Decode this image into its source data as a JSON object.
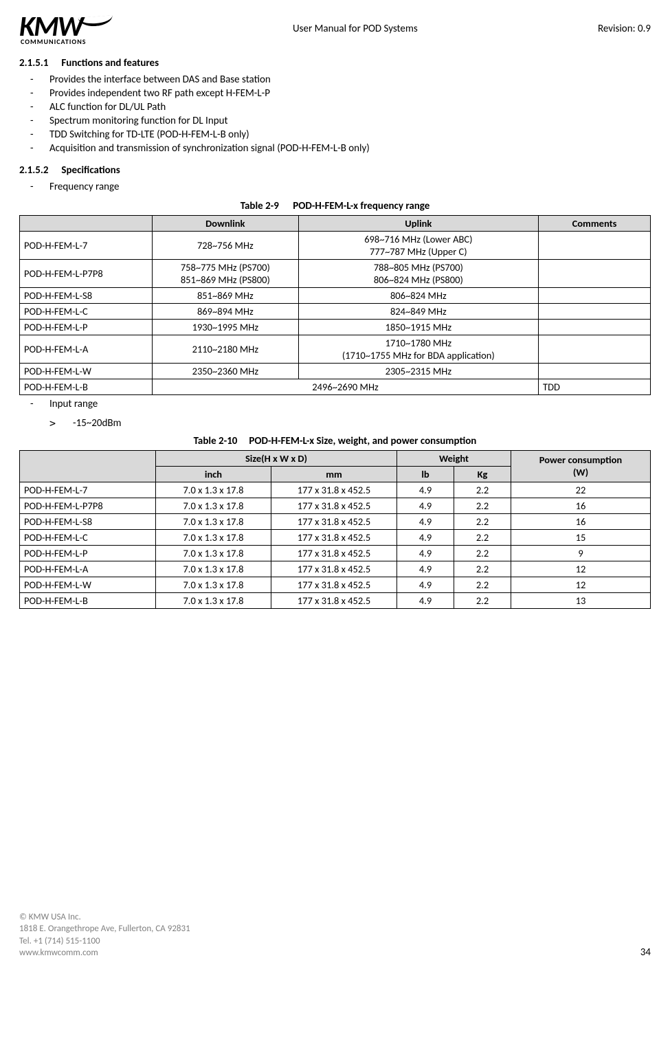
{
  "header": {
    "logo_main": "KMW",
    "logo_sub": "COMMUNICATIONS",
    "title": "User Manual for POD Systems",
    "revision": "Revision: 0.9"
  },
  "sec1": {
    "num": "2.1.5.1",
    "title": "Functions and features"
  },
  "features": [
    "Provides the interface between DAS and Base station",
    "Provides independent two RF path except H-FEM-L-P",
    "ALC function for DL/UL Path",
    "Spectrum monitoring function for DL Input",
    "TDD Switching for TD-LTE (POD-H-FEM-L-B only)",
    " Acquisition and transmission of synchronization signal  (POD-H-FEM-L-B only)"
  ],
  "sec2": {
    "num": "2.1.5.2",
    "title": "Specifications"
  },
  "spec_item1": "Frequency range",
  "table1": {
    "caption_label": "Table 2-9",
    "caption_title": "POD-H-FEM-L-x frequency range",
    "headers": {
      "c1": "Downlink",
      "c2": "Uplink",
      "c3": "Comments"
    },
    "rows": [
      {
        "name": "POD-H-FEM-L-7",
        "dl": "728~756 MHz",
        "ul": "698~716 MHz (Lower ABC)\n777~787 MHz (Upper C)",
        "comments": ""
      },
      {
        "name": "POD-H-FEM-L-P7P8",
        "dl": "758~775 MHz (PS700)\n851~869 MHz (PS800)",
        "ul": "788~805 MHz (PS700)\n806~824 MHz (PS800)",
        "comments": ""
      },
      {
        "name": "POD-H-FEM-L-S8",
        "dl": "851~869 MHz",
        "ul": "806~824 MHz",
        "comments": ""
      },
      {
        "name": "POD-H-FEM-L-C",
        "dl": "869~894 MHz",
        "ul": "824~849 MHz",
        "comments": ""
      },
      {
        "name": "POD-H-FEM-L-P",
        "dl": "1930~1995 MHz",
        "ul": "1850~1915 MHz",
        "comments": ""
      },
      {
        "name": "POD-H-FEM-L-A",
        "dl": "2110~2180 MHz",
        "ul": "1710~1780 MHz\n(1710~1755 MHz for BDA application)",
        "comments": ""
      },
      {
        "name": "POD-H-FEM-L-W",
        "dl": "2350~2360 MHz",
        "ul": "2305~2315 MHz",
        "comments": ""
      }
    ],
    "last_row": {
      "name": "POD-H-FEM-L-B",
      "dlul": "2496~2690 MHz",
      "comments": "TDD"
    }
  },
  "spec_item2": "Input range",
  "spec_item2_sub": "-15~20dBm",
  "table2": {
    "caption_label": "Table 2-10",
    "caption_title": "POD-H-FEM-L-x Size, weight, and power consumption",
    "headers": {
      "size": "Size(H x W x D)",
      "weight": "Weight",
      "power": "Power consumption\n(W)",
      "inch": "inch",
      "mm": "mm",
      "lb": "lb",
      "kg": "Kg"
    },
    "rows": [
      {
        "name": "POD-H-FEM-L-7",
        "inch": "7.0 x 1.3 x 17.8",
        "mm": "177 x 31.8 x 452.5",
        "lb": "4.9",
        "kg": "2.2",
        "pw": "22"
      },
      {
        "name": "POD-H-FEM-L-P7P8",
        "inch": "7.0 x 1.3 x 17.8",
        "mm": "177 x 31.8 x 452.5",
        "lb": "4.9",
        "kg": "2.2",
        "pw": "16"
      },
      {
        "name": "POD-H-FEM-L-S8",
        "inch": "7.0 x 1.3 x 17.8",
        "mm": "177 x 31.8 x 452.5",
        "lb": "4.9",
        "kg": "2.2",
        "pw": "16"
      },
      {
        "name": "POD-H-FEM-L-C",
        "inch": "7.0 x 1.3 x 17.8",
        "mm": "177 x 31.8 x 452.5",
        "lb": "4.9",
        "kg": "2.2",
        "pw": "15"
      },
      {
        "name": "POD-H-FEM-L-P",
        "inch": "7.0 x 1.3 x 17.8",
        "mm": "177 x 31.8 x 452.5",
        "lb": "4.9",
        "kg": "2.2",
        "pw": "9"
      },
      {
        "name": "POD-H-FEM-L-A",
        "inch": "7.0 x 1.3 x 17.8",
        "mm": "177 x 31.8 x 452.5",
        "lb": "4.9",
        "kg": "2.2",
        "pw": "12"
      },
      {
        "name": "POD-H-FEM-L-W",
        "inch": "7.0 x 1.3 x 17.8",
        "mm": "177 x 31.8 x 452.5",
        "lb": "4.9",
        "kg": "2.2",
        "pw": "12"
      },
      {
        "name": "POD-H-FEM-L-B",
        "inch": "7.0 x 1.3 x 17.8",
        "mm": "177 x 31.8 x 452.5",
        "lb": "4.9",
        "kg": "2.2",
        "pw": "13"
      }
    ]
  },
  "footer": {
    "l1": "© KMW USA Inc.",
    "l2": "1818 E. Orangethrope Ave, Fullerton, CA 92831",
    "l3": "Tel. +1 (714) 515-1100",
    "l4": "www.kmwcomm.com",
    "page": "34"
  }
}
